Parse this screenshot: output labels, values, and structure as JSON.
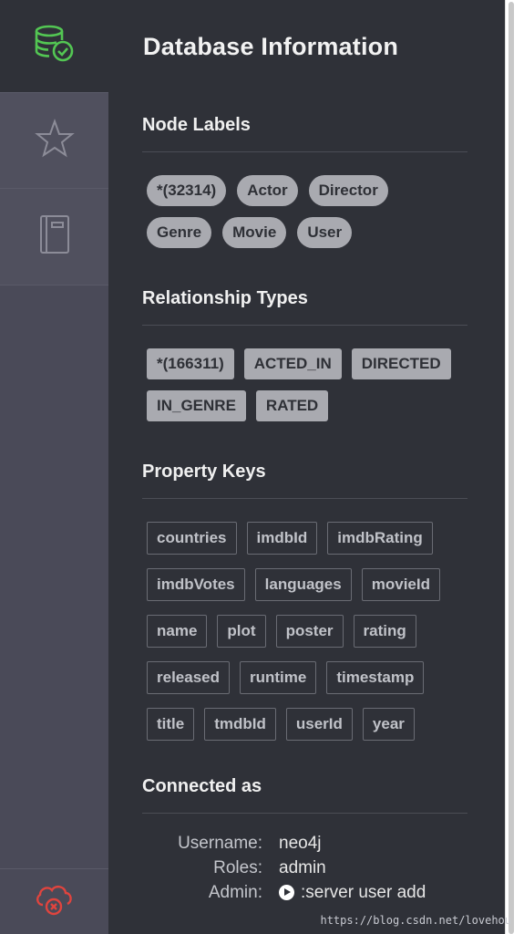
{
  "colors": {
    "panel_bg": "#2f3138",
    "rail_bg": "#4a4a58",
    "accent_green": "#53c653",
    "error_red": "#e0443e",
    "chip_fill": "#a9aab0"
  },
  "sidebar": {
    "items": [
      {
        "icon": "database-check-icon",
        "active": true
      },
      {
        "icon": "star-icon",
        "active": false
      },
      {
        "icon": "book-icon",
        "active": false
      },
      {
        "icon": "cloud-error-icon",
        "active": false
      }
    ]
  },
  "page": {
    "title": "Database Information"
  },
  "node_labels": {
    "title": "Node Labels",
    "items": [
      "*(32314)",
      "Actor",
      "Director",
      "Genre",
      "Movie",
      "User"
    ]
  },
  "relationship_types": {
    "title": "Relationship Types",
    "items": [
      "*(166311)",
      "ACTED_IN",
      "DIRECTED",
      "IN_GENRE",
      "RATED"
    ]
  },
  "property_keys": {
    "title": "Property Keys",
    "items": [
      "countries",
      "imdbId",
      "imdbRating",
      "imdbVotes",
      "languages",
      "movieId",
      "name",
      "plot",
      "poster",
      "rating",
      "released",
      "runtime",
      "timestamp",
      "title",
      "tmdbId",
      "userId",
      "year"
    ]
  },
  "connected_as": {
    "title": "Connected as",
    "username_label": "Username:",
    "username": "neo4j",
    "roles_label": "Roles:",
    "roles": "admin",
    "admin_label": "Admin:",
    "admin_command": ":server user add"
  },
  "watermark": "https://blog.csdn.net/lovehou"
}
